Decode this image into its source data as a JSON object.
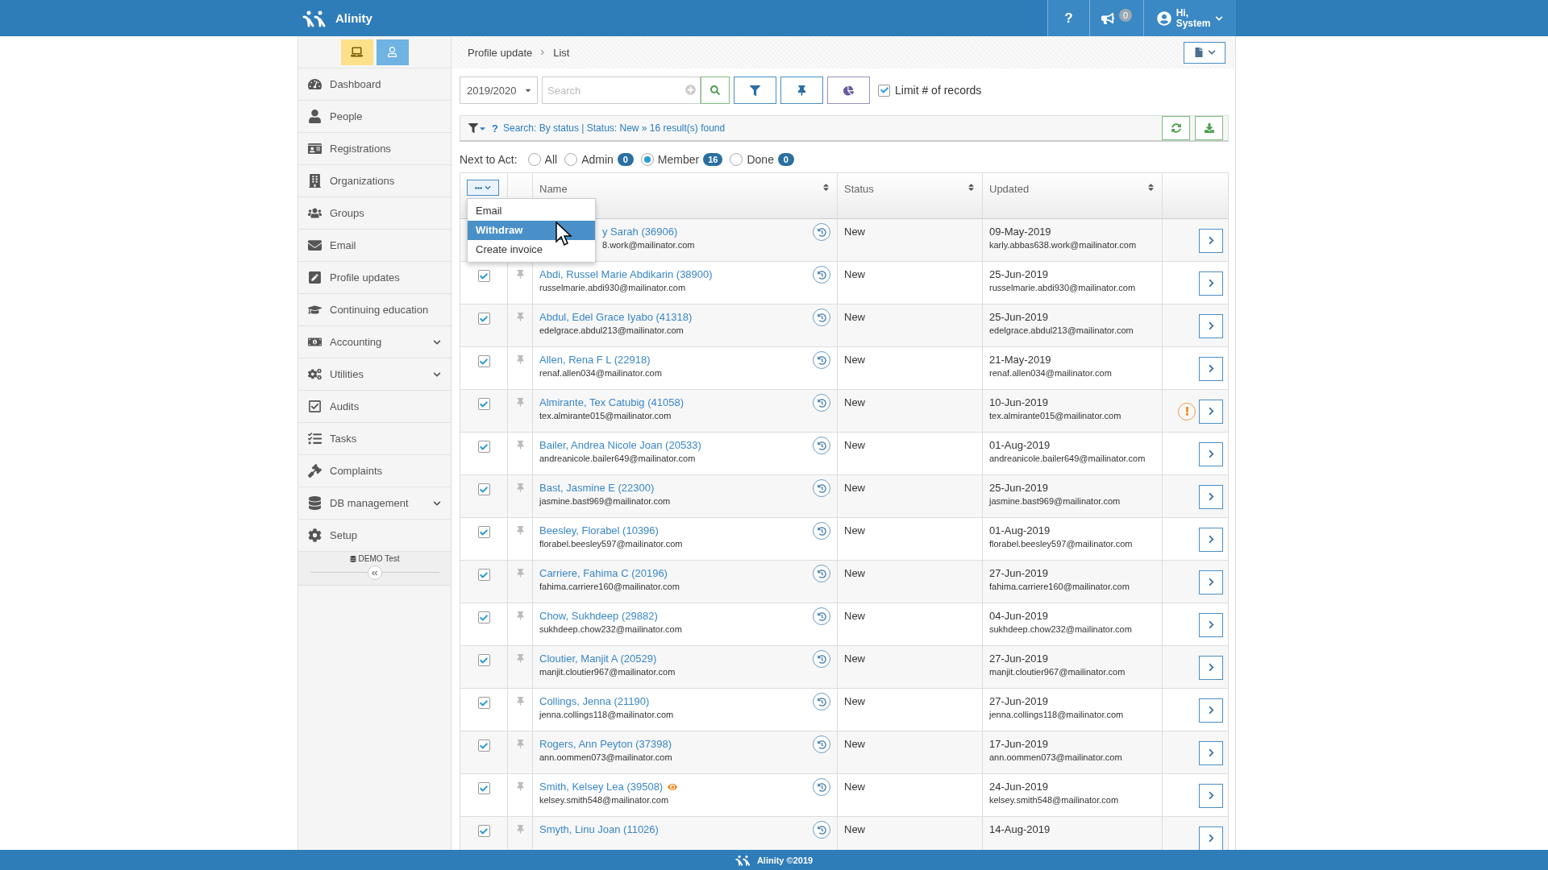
{
  "app": {
    "name": "Alinity"
  },
  "topbar": {
    "help": "?",
    "notifications": "0",
    "greeting": "Hi,",
    "user": "System"
  },
  "view_switch": [
    {
      "kind": "desktop",
      "selected": true
    },
    {
      "kind": "person",
      "selected": false
    }
  ],
  "sidebar": {
    "items": [
      {
        "label": "Dashboard",
        "expandable": false
      },
      {
        "label": "People",
        "expandable": false
      },
      {
        "label": "Registrations",
        "expandable": false
      },
      {
        "label": "Organizations",
        "expandable": false
      },
      {
        "label": "Groups",
        "expandable": false
      },
      {
        "label": "Email",
        "expandable": false
      },
      {
        "label": "Profile updates",
        "expandable": false
      },
      {
        "label": "Continuing education",
        "expandable": false
      },
      {
        "label": "Accounting",
        "expandable": true
      },
      {
        "label": "Utilities",
        "expandable": true
      },
      {
        "label": "Audits",
        "expandable": false
      },
      {
        "label": "Tasks",
        "expandable": false
      },
      {
        "label": "Complaints",
        "expandable": false
      },
      {
        "label": "DB management",
        "expandable": true
      },
      {
        "label": "Setup",
        "expandable": false
      }
    ],
    "database": "DEMO Test"
  },
  "breadcrumb": [
    "Profile update",
    "List"
  ],
  "toolbar": {
    "year": "2019/2020",
    "search_placeholder": "Search",
    "limit": {
      "label": "Limit # of records",
      "checked": true
    }
  },
  "summary": {
    "help": "?",
    "text": "Search: By status | Status: New » 16 result(s) found"
  },
  "next_to_act": {
    "label": "Next to Act:",
    "options": [
      {
        "label": "All",
        "selected": false
      },
      {
        "label": "Admin",
        "count": "0",
        "selected": false
      },
      {
        "label": "Member",
        "count": "16",
        "selected": true
      },
      {
        "label": "Done",
        "count": "0",
        "selected": false
      }
    ]
  },
  "bulk_menu": {
    "items": [
      {
        "label": "Email",
        "selected": false
      },
      {
        "label": "Withdraw",
        "selected": true
      },
      {
        "label": "Create invoice",
        "selected": false
      }
    ]
  },
  "table": {
    "columns": [
      "Name",
      "Status",
      "Updated"
    ],
    "rows": [
      {
        "name": "y Sarah (36906)",
        "email": "8.work@mailinator.com",
        "status": "New",
        "updated": "09-May-2019",
        "updated_email": "karly.abbas638.work@mailinator.com",
        "covered": true
      },
      {
        "checked": true,
        "name": "Abdi, Russel Marie Abdikarin (38900)",
        "email": "russelmarie.abdi930@mailinator.com",
        "status": "New",
        "updated": "25-Jun-2019",
        "updated_email": "russelmarie.abdi930@mailinator.com"
      },
      {
        "checked": true,
        "name": "Abdul, Edel Grace Iyabo (41318)",
        "email": "edelgrace.abdul213@mailinator.com",
        "status": "New",
        "updated": "25-Jun-2019",
        "updated_email": "edelgrace.abdul213@mailinator.com"
      },
      {
        "checked": true,
        "name": "Allen, Rena F L (22918)",
        "email": "renaf.allen034@mailinator.com",
        "status": "New",
        "updated": "21-May-2019",
        "updated_email": "renaf.allen034@mailinator.com"
      },
      {
        "checked": true,
        "name": "Almirante, Tex Catubig (41058)",
        "email": "tex.almirante015@mailinator.com",
        "status": "New",
        "updated": "10-Jun-2019",
        "updated_email": "tex.almirante015@mailinator.com",
        "warning": true
      },
      {
        "checked": true,
        "name": "Bailer, Andrea Nicole Joan (20533)",
        "email": "andreanicole.bailer649@mailinator.com",
        "status": "New",
        "updated": "01-Aug-2019",
        "updated_email": "andreanicole.bailer649@mailinator.com"
      },
      {
        "checked": true,
        "name": "Bast, Jasmine E (22300)",
        "email": "jasmine.bast969@mailinator.com",
        "status": "New",
        "updated": "25-Jun-2019",
        "updated_email": "jasmine.bast969@mailinator.com"
      },
      {
        "checked": true,
        "name": "Beesley, Florabel (10396)",
        "email": "florabel.beesley597@mailinator.com",
        "status": "New",
        "updated": "01-Aug-2019",
        "updated_email": "florabel.beesley597@mailinator.com"
      },
      {
        "checked": true,
        "name": "Carriere, Fahima C (20196)",
        "email": "fahima.carriere160@mailinator.com",
        "status": "New",
        "updated": "27-Jun-2019",
        "updated_email": "fahima.carriere160@mailinator.com"
      },
      {
        "checked": true,
        "name": "Chow, Sukhdeep (29882)",
        "email": "sukhdeep.chow232@mailinator.com",
        "status": "New",
        "updated": "04-Jun-2019",
        "updated_email": "sukhdeep.chow232@mailinator.com"
      },
      {
        "checked": true,
        "name": "Cloutier, Manjit A (20529)",
        "email": "manjit.cloutier967@mailinator.com",
        "status": "New",
        "updated": "27-Jun-2019",
        "updated_email": "manjit.cloutier967@mailinator.com"
      },
      {
        "checked": true,
        "name": "Collings, Jenna (21190)",
        "email": "jenna.collings118@mailinator.com",
        "status": "New",
        "updated": "27-Jun-2019",
        "updated_email": "jenna.collings118@mailinator.com"
      },
      {
        "checked": true,
        "name": "Rogers, Ann Peyton (37398)",
        "email": "ann.oommen073@mailinator.com",
        "status": "New",
        "updated": "17-Jun-2019",
        "updated_email": "ann.oommen073@mailinator.com"
      },
      {
        "checked": true,
        "name": "Smith, Kelsey Lea (39508)",
        "email": "kelsey.smith548@mailinator.com",
        "status": "New",
        "updated": "24-Jun-2019",
        "updated_email": "kelsey.smith548@mailinator.com",
        "watched": true
      },
      {
        "checked": true,
        "name": "Smyth, Linu Joan (11026)",
        "status": "New",
        "updated": "14-Aug-2019"
      }
    ]
  },
  "footer": "Alinity ©2019"
}
